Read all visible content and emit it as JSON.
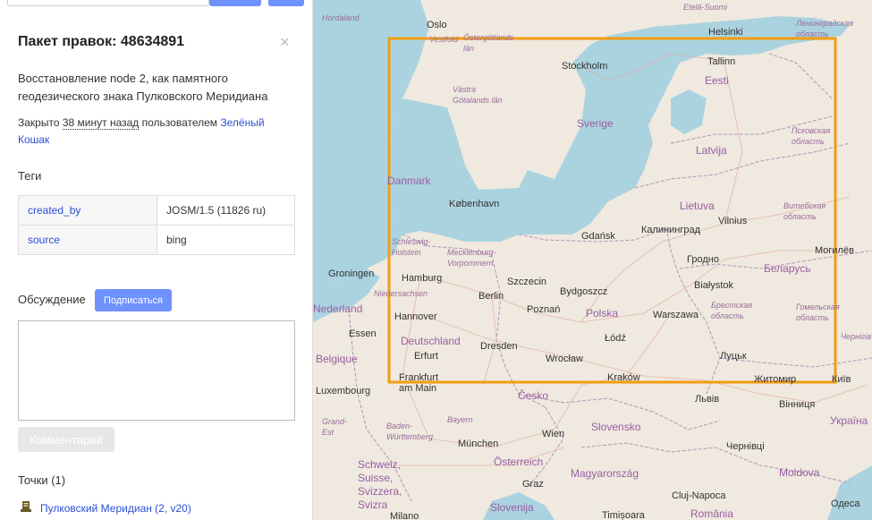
{
  "sidebar": {
    "title": "Пакет правок: 48634891",
    "close_symbol": "×",
    "comment": "Восстановление node 2, как памятного геодезического знака Пулковского Меридиана",
    "closed": {
      "prefix": "Закрыто",
      "time": "38 минут назад",
      "middle": "пользователем",
      "user": "Зелёный Кошак"
    },
    "tags_heading": "Теги",
    "tags": [
      {
        "key": "created_by",
        "value": "JOSM/1.5 (11826 ru)"
      },
      {
        "key": "source",
        "value": "bing"
      }
    ],
    "discussion_label": "Обсуждение",
    "subscribe_label": "Подписаться",
    "comment_button_label": "Комментарий",
    "points_heading": "Точки (1)",
    "point_link": "Пулковский Меридиан (2, v20)"
  },
  "map": {
    "bbox_color": "#f39c12",
    "water_color": "#aad3df",
    "land_color": "#efe9df",
    "labels": {
      "oslo": "Oslo",
      "etela_suomi": "Etelä-Suomi",
      "helsinki": "Helsinki",
      "leningrad": "Ленинградская область",
      "hordaland": "Hordaland",
      "vestfold": "Vestfold",
      "ostergotlands": "Östergötlands län",
      "vastra_gotalands": "Västra Götalands län",
      "stockholm": "Stockholm",
      "tallinn": "Tallinn",
      "eesti": "Eesti",
      "sverige": "Sverige",
      "pskov": "Псковская область",
      "latvija": "Latvija",
      "danmark": "Danmark",
      "kobenhavn": "København",
      "lietuva": "Lietuva",
      "vilnius": "Vilnius",
      "vitebsk": "Витебская область",
      "schleswig": "Schleswig-Holstein",
      "gdansk": "Gdańsk",
      "kaliningrad": "Калининград",
      "mogilev": "Могилёв",
      "groningen": "Groningen",
      "hamburg": "Hamburg",
      "mecklenburg": "Mecklenburg-Vorpommern",
      "grodno": "Гродно",
      "belarus": "Беларусь",
      "szczecin": "Szczecin",
      "niedersachsen": "Niedersachsen",
      "berlin": "Berlin",
      "bydgoszcz": "Bydgoszcz",
      "bialystok": "Białystok",
      "nederland": "Nederland",
      "hannover": "Hannover",
      "poznan": "Poznań",
      "polska": "Polska",
      "brest": "Брестская область",
      "gomel": "Гомельская область",
      "essen": "Essen",
      "warszawa": "Warszawa",
      "deutschland": "Deutschland",
      "lodz": "Łódź",
      "chernihiv": "Чернігів",
      "erfurt": "Erfurt",
      "dresden": "Dresden",
      "belgique": "Belgique",
      "wroclaw": "Wrocław",
      "lutsk": "Луцьк",
      "frankfurt": "Frankfurt am Main",
      "krakow": "Kraków",
      "zhytomyr": "Житомир",
      "kyiv": "Київ",
      "luxembourg": "Luxembourg",
      "cesko": "Česko",
      "lviv": "Львів",
      "vinnytsia": "Вінниця",
      "grand_est": "Grand-Est",
      "bayern": "Bayern",
      "slovensko": "Slovensko",
      "ukraina": "Україна",
      "baden": "Baden-Württemberg",
      "wien": "Wien",
      "munchen": "München",
      "chernivtsi": "Чернівці",
      "osterreich": "Österreich",
      "schweiz": "Schweiz, Suisse, Svizzera, Svizra",
      "magyarorszag": "Magyarország",
      "moldova": "Moldova",
      "graz": "Graz",
      "cluj": "Cluj-Napoca",
      "milano": "Milano",
      "slovenija": "Slovenija",
      "timisoara": "Timișoara",
      "romania": "România",
      "odesa": "Одеса"
    }
  }
}
